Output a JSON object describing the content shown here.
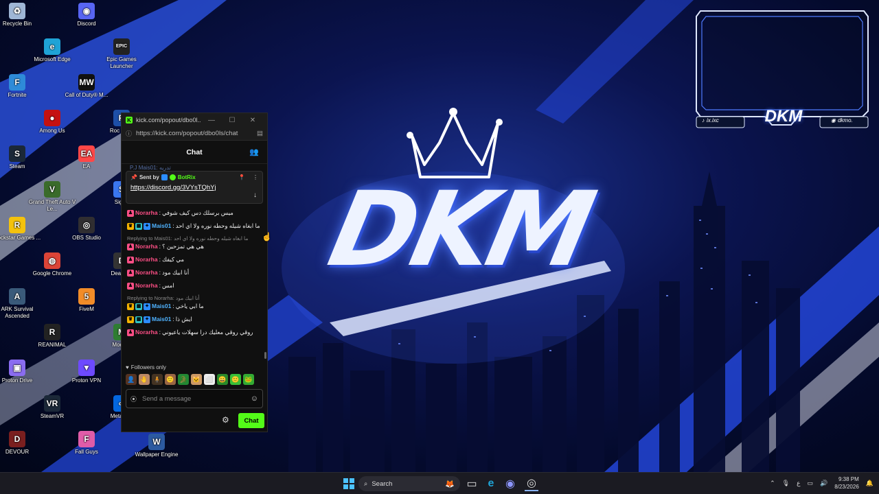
{
  "desktop": {
    "icons": [
      {
        "label": "Recycle Bin",
        "icon": "recycle-bin-icon",
        "color": "#9fb6d6",
        "glyph": "♻"
      },
      {
        "label": "Discord",
        "icon": "discord-icon",
        "color": "#5865f2",
        "glyph": "◉"
      },
      {
        "label": "Microsoft Edge",
        "icon": "edge-icon",
        "color": "#1fa3d6",
        "glyph": "e"
      },
      {
        "label": "Epic Games Launcher",
        "icon": "epic-games-icon",
        "color": "#222222",
        "glyph": "EPIC"
      },
      {
        "label": "Fortnite",
        "icon": "fortnite-icon",
        "color": "#2e8bd8",
        "glyph": "F"
      },
      {
        "label": "Call of Duty® M...",
        "icon": "call-of-duty-icon",
        "color": "#111111",
        "glyph": "MW"
      },
      {
        "label": "Among Us",
        "icon": "among-us-icon",
        "color": "#c51111",
        "glyph": "●"
      },
      {
        "label": "Roc Leag",
        "icon": "rocket-league-icon",
        "color": "#1d4fa8",
        "glyph": "R"
      },
      {
        "label": "Steam",
        "icon": "steam-icon",
        "color": "#1b2838",
        "glyph": "S"
      },
      {
        "label": "EA",
        "icon": "ea-icon",
        "color": "#ff4747",
        "glyph": "EA"
      },
      {
        "label": "Grand Theft Auto V Le...",
        "icon": "gta-icon",
        "color": "#3a6b2a",
        "glyph": "V"
      },
      {
        "label": "Signa",
        "icon": "signal-icon",
        "color": "#3a76f0",
        "glyph": "S"
      },
      {
        "label": "Rockstar Games ...",
        "icon": "rockstar-icon",
        "color": "#f4c20d",
        "glyph": "R"
      },
      {
        "label": "OBS Studio",
        "icon": "obs-icon",
        "color": "#302e31",
        "glyph": "◎"
      },
      {
        "label": "Google Chrome",
        "icon": "chrome-icon",
        "color": "#db4437",
        "glyph": "◍"
      },
      {
        "label": "Dea Day",
        "icon": "dead-by-daylight-icon",
        "color": "#333333",
        "glyph": "D"
      },
      {
        "label": "ARK Survival Ascended",
        "icon": "ark-icon",
        "color": "#3a5a7a",
        "glyph": "A"
      },
      {
        "label": "FiveM",
        "icon": "fivem-icon",
        "color": "#f28c28",
        "glyph": "5"
      },
      {
        "label": "REANIMAL",
        "icon": "reanimal-icon",
        "color": "#222222",
        "glyph": "R"
      },
      {
        "label": "Mod Ap",
        "icon": "mod-app-icon",
        "color": "#2e7d32",
        "glyph": "M"
      },
      {
        "label": "Proton Drive",
        "icon": "proton-drive-icon",
        "color": "#8a6cf0",
        "glyph": "▣"
      },
      {
        "label": "Proton VPN",
        "icon": "proton-vpn-icon",
        "color": "#6d4aff",
        "glyph": "▼"
      },
      {
        "label": "SteamVR",
        "icon": "steamvr-icon",
        "color": "#1b2838",
        "glyph": "VR"
      },
      {
        "label": "Meta H L",
        "icon": "meta-horizon-icon",
        "color": "#0467df",
        "glyph": "∞"
      },
      {
        "label": "DEVOUR",
        "icon": "devour-icon",
        "color": "#7a1f1f",
        "glyph": "D"
      },
      {
        "label": "Fall Guys",
        "icon": "fall-guys-icon",
        "color": "#e05ca8",
        "glyph": "F"
      },
      {
        "label": "Wallpaper Engine",
        "icon": "wallpaper-engine-icon",
        "color": "#2c5aa0",
        "glyph": "W"
      }
    ]
  },
  "overlay": {
    "logo": "DKM",
    "left_handle": "ix.ixc",
    "right_handle": "dkmo."
  },
  "wallpaper": {
    "logo": "DKM"
  },
  "chat_window": {
    "title": "kick.com/popout/dbo0l...",
    "url": "https://kick.com/popout/dbo0ls/chat",
    "header": "Chat",
    "partial_top": "P.J Mais01: تدريه",
    "pinned": {
      "sent_by": "Sent by",
      "bot_name": "BotRix",
      "link": "https://discord.gg/3VYsTQhYj"
    },
    "messages": [
      {
        "type": "msg",
        "user": "Norarha",
        "color": "#ff4f86",
        "badges": [
          "norarha"
        ],
        "text": "ميس برسلك دس كيف شوفي"
      },
      {
        "type": "msg",
        "user": "Mais01",
        "color": "#4fb3ff",
        "badges": [
          "crown",
          "sub",
          "verified"
        ],
        "text": "ما ابغاه شيله وحطه نوره ولا اي احد"
      },
      {
        "type": "reply",
        "text": "Replying to Mais01: ما ابغاه شيله وحطه نوره ولا اي احد"
      },
      {
        "type": "msg",
        "user": "Norarha",
        "color": "#ff4f86",
        "badges": [
          "norarha"
        ],
        "text": "هي هي تمزحين ؟"
      },
      {
        "type": "msg",
        "user": "Norarha",
        "color": "#ff4f86",
        "badges": [
          "norarha"
        ],
        "text": "مي كيفك"
      },
      {
        "type": "msg",
        "user": "Norarha",
        "color": "#ff4f86",
        "badges": [
          "norarha"
        ],
        "text": "أنا ابيك مود"
      },
      {
        "type": "msg",
        "user": "Norarha",
        "color": "#ff4f86",
        "badges": [
          "norarha"
        ],
        "text": "امس"
      },
      {
        "type": "reply",
        "text": "Replying to Norarha: أنا ابيك مود"
      },
      {
        "type": "msg",
        "user": "Mais01",
        "color": "#4fb3ff",
        "badges": [
          "crown",
          "sub",
          "verified"
        ],
        "text": "ما ابي ياخي"
      },
      {
        "type": "msg",
        "user": "Mais01",
        "color": "#4fb3ff",
        "badges": [
          "crown",
          "sub",
          "verified"
        ],
        "text": "ايش ذا"
      },
      {
        "type": "msg",
        "user": "Norarha",
        "color": "#ff4f86",
        "badges": [
          "norarha"
        ],
        "text": "روقي روقي معليك درا سهلات ياعيوني"
      }
    ],
    "followers_only": "Followers only",
    "emotes": [
      "👤",
      "🤚",
      "🧍",
      "🙂",
      "🐊",
      "🐱",
      "⬜",
      "😀",
      "🙂",
      "🐸"
    ],
    "input_placeholder": "Send a message",
    "send_label": "Chat"
  },
  "taskbar": {
    "search_label": "Search",
    "time": "9:38 PM",
    "date": "8/23/2026",
    "lang": "ع"
  }
}
